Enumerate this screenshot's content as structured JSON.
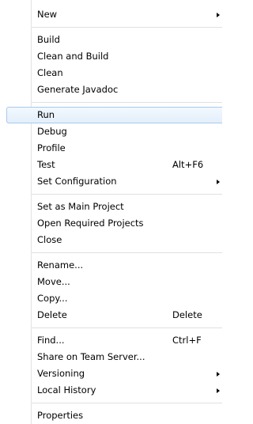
{
  "menu": {
    "groups": [
      {
        "items": [
          {
            "label": "New",
            "submenu": true
          }
        ]
      },
      {
        "items": [
          {
            "label": "Build"
          },
          {
            "label": "Clean and Build"
          },
          {
            "label": "Clean"
          },
          {
            "label": "Generate Javadoc"
          }
        ]
      },
      {
        "items": [
          {
            "label": "Run",
            "highlighted": true
          },
          {
            "label": "Debug"
          },
          {
            "label": "Profile"
          },
          {
            "label": "Test",
            "shortcut": "Alt+F6"
          },
          {
            "label": "Set Configuration",
            "submenu": true
          }
        ]
      },
      {
        "items": [
          {
            "label": "Set as Main Project"
          },
          {
            "label": "Open Required Projects"
          },
          {
            "label": "Close"
          }
        ]
      },
      {
        "items": [
          {
            "label": "Rename..."
          },
          {
            "label": "Move..."
          },
          {
            "label": "Copy..."
          },
          {
            "label": "Delete",
            "shortcut": "Delete"
          }
        ]
      },
      {
        "items": [
          {
            "label": "Find...",
            "shortcut": "Ctrl+F"
          },
          {
            "label": "Share on Team Server..."
          },
          {
            "label": "Versioning",
            "submenu": true
          },
          {
            "label": "Local History",
            "submenu": true
          }
        ]
      },
      {
        "items": [
          {
            "label": "Properties"
          }
        ]
      }
    ]
  },
  "colors": {
    "highlight_border": "#a8c9ed",
    "highlight_fill": "#e3effc",
    "separator": "#e0e0e0",
    "gutter": "#e2e3e3"
  },
  "icons": {
    "submenu": "submenu-arrow-icon"
  }
}
